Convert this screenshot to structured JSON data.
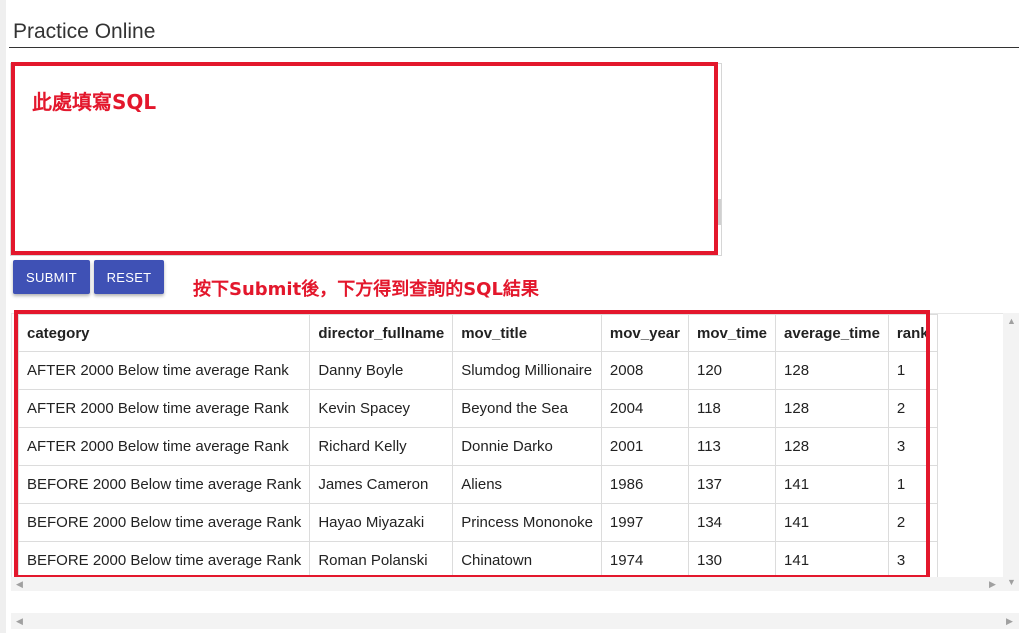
{
  "page": {
    "title": "Practice Online"
  },
  "editor": {
    "annotation": "此處填寫SQL"
  },
  "buttons": {
    "submit": "SUBMIT",
    "reset": "RESET"
  },
  "annotations": {
    "result_hint": "按下Submit後，下方得到查詢的SQL結果"
  },
  "results": {
    "columns": [
      "category",
      "director_fullname",
      "mov_title",
      "mov_year",
      "mov_time",
      "average_time",
      "rank"
    ],
    "rows": [
      [
        "AFTER 2000 Below time average Rank",
        "Danny Boyle",
        "Slumdog Millionaire",
        "2008",
        "120",
        "128",
        "1"
      ],
      [
        "AFTER 2000 Below time average Rank",
        "Kevin Spacey",
        "Beyond the Sea",
        "2004",
        "118",
        "128",
        "2"
      ],
      [
        "AFTER 2000 Below time average Rank",
        "Richard Kelly",
        "Donnie Darko",
        "2001",
        "113",
        "128",
        "3"
      ],
      [
        "BEFORE 2000 Below time average Rank",
        "James Cameron",
        "Aliens",
        "1986",
        "137",
        "141",
        "1"
      ],
      [
        "BEFORE 2000 Below time average Rank",
        "Hayao Miyazaki",
        "Princess Mononoke",
        "1997",
        "134",
        "141",
        "2"
      ],
      [
        "BEFORE 2000 Below time average Rank",
        "Roman Polanski",
        "Chinatown",
        "1974",
        "130",
        "141",
        "3"
      ]
    ]
  },
  "colors": {
    "accent": "#3f51b5",
    "annotation": "#e3172c"
  },
  "icons": {
    "scroll_up": "triangle-up-icon",
    "scroll_down": "triangle-down-icon",
    "scroll_left": "triangle-left-icon",
    "scroll_right": "triangle-right-icon"
  }
}
